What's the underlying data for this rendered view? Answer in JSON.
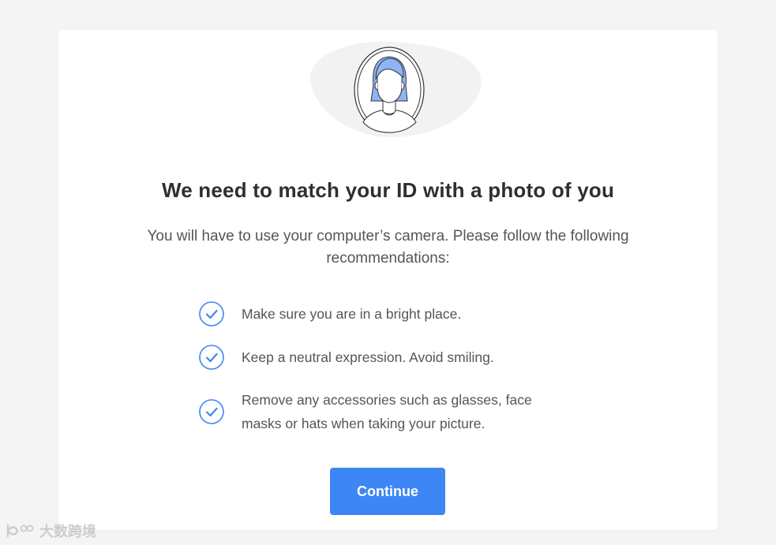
{
  "main": {
    "title": "We need to match your ID with a photo of you",
    "subtitle": "You will have to use your computer’s camera. Please follow the following recommendations:",
    "recommendations": [
      {
        "icon": "check-circle-icon",
        "text": "Make sure you are in a bright place."
      },
      {
        "icon": "check-circle-icon",
        "text": "Keep a neutral expression. Avoid smiling."
      },
      {
        "icon": "check-circle-icon",
        "text": "Remove any accessories such as glasses, face masks or hats when taking your picture."
      }
    ],
    "continue_label": "Continue"
  },
  "illustration": {
    "icon": "face-portrait-icon"
  },
  "watermark": {
    "text": "大数跨境"
  },
  "colors": {
    "accent": "#3d86f5",
    "check": "#3d86f5",
    "hair": "#8fb4f5",
    "background": "#f4f4f4",
    "card": "#ffffff",
    "title": "#2f2f2f",
    "body_text": "#555555"
  }
}
